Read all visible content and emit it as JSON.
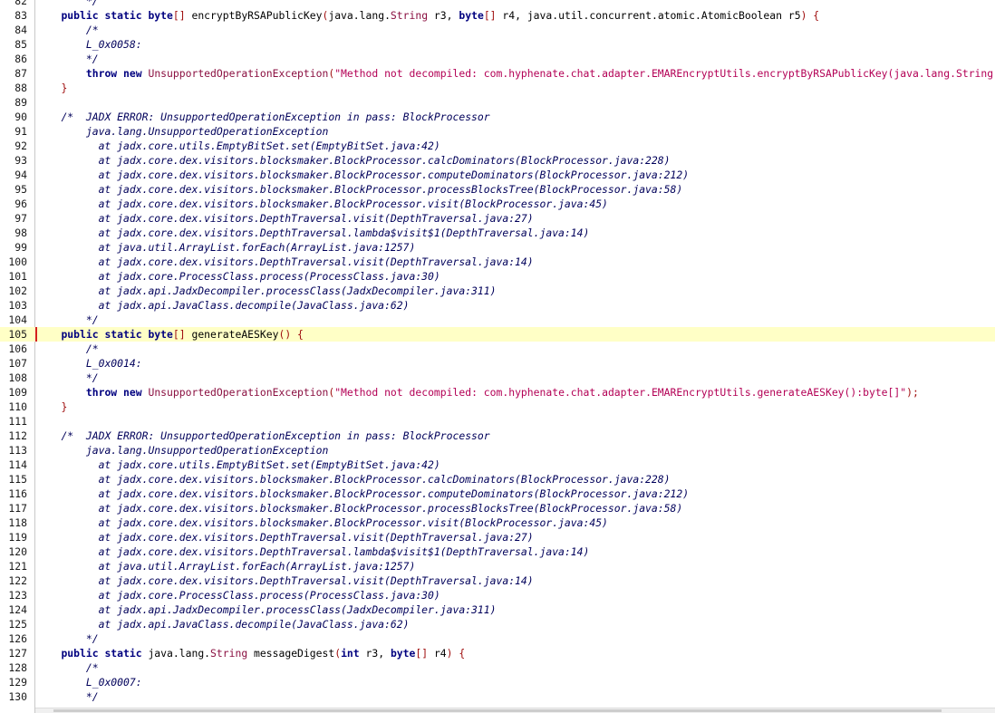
{
  "editor": {
    "current_line": 105,
    "lines": [
      {
        "n": "82",
        "t": [
          {
            "s": "        ",
            "c": "plain"
          },
          {
            "s": "*/",
            "c": "cm"
          }
        ]
      },
      {
        "n": "83",
        "t": [
          {
            "s": "    ",
            "c": "plain"
          },
          {
            "s": "public static byte",
            "c": "kw"
          },
          {
            "s": "[]",
            "c": "pn"
          },
          {
            "s": " encryptByRSAPublicKey",
            "c": "plain"
          },
          {
            "s": "(",
            "c": "pn"
          },
          {
            "s": "java.lang.",
            "c": "plain"
          },
          {
            "s": "String",
            "c": "type"
          },
          {
            "s": " r3, ",
            "c": "plain"
          },
          {
            "s": "byte",
            "c": "kw"
          },
          {
            "s": "[]",
            "c": "pn"
          },
          {
            "s": " r4, java.util.concurrent.atomic.AtomicBoolean r5",
            "c": "plain"
          },
          {
            "s": ") {",
            "c": "pn"
          }
        ]
      },
      {
        "n": "84",
        "t": [
          {
            "s": "        ",
            "c": "plain"
          },
          {
            "s": "/*",
            "c": "cm"
          }
        ]
      },
      {
        "n": "85",
        "t": [
          {
            "s": "        ",
            "c": "plain"
          },
          {
            "s": "L_0x0058:",
            "c": "cm"
          }
        ]
      },
      {
        "n": "86",
        "t": [
          {
            "s": "        ",
            "c": "plain"
          },
          {
            "s": "*/",
            "c": "cm"
          }
        ]
      },
      {
        "n": "87",
        "t": [
          {
            "s": "        ",
            "c": "plain"
          },
          {
            "s": "throw new",
            "c": "kw"
          },
          {
            "s": " UnsupportedOperationException",
            "c": "type"
          },
          {
            "s": "(",
            "c": "pn"
          },
          {
            "s": "\"Method not decompiled: com.hyphenate.chat.adapter.EMAREncryptUtils.encryptByRSAPublicKey(java.lang.String, byte[], java.util.concurrent.atomic.AtomicBoolean):byte[]\"",
            "c": "str"
          },
          {
            "s": ");",
            "c": "pn"
          }
        ]
      },
      {
        "n": "88",
        "t": [
          {
            "s": "    ",
            "c": "plain"
          },
          {
            "s": "}",
            "c": "pn"
          }
        ]
      },
      {
        "n": "89",
        "t": []
      },
      {
        "n": "90",
        "t": [
          {
            "s": "    ",
            "c": "plain"
          },
          {
            "s": "/*  JADX ERROR: UnsupportedOperationException in pass: BlockProcessor",
            "c": "cm"
          }
        ]
      },
      {
        "n": "91",
        "t": [
          {
            "s": "        ",
            "c": "plain"
          },
          {
            "s": "java.lang.UnsupportedOperationException",
            "c": "cm"
          }
        ]
      },
      {
        "n": "92",
        "t": [
          {
            "s": "          ",
            "c": "plain"
          },
          {
            "s": "at jadx.core.utils.EmptyBitSet.set(EmptyBitSet.java:42)",
            "c": "cm"
          }
        ]
      },
      {
        "n": "93",
        "t": [
          {
            "s": "          ",
            "c": "plain"
          },
          {
            "s": "at jadx.core.dex.visitors.blocksmaker.BlockProcessor.calcDominators(BlockProcessor.java:228)",
            "c": "cm"
          }
        ]
      },
      {
        "n": "94",
        "t": [
          {
            "s": "          ",
            "c": "plain"
          },
          {
            "s": "at jadx.core.dex.visitors.blocksmaker.BlockProcessor.computeDominators(BlockProcessor.java:212)",
            "c": "cm"
          }
        ]
      },
      {
        "n": "95",
        "t": [
          {
            "s": "          ",
            "c": "plain"
          },
          {
            "s": "at jadx.core.dex.visitors.blocksmaker.BlockProcessor.processBlocksTree(BlockProcessor.java:58)",
            "c": "cm"
          }
        ]
      },
      {
        "n": "96",
        "t": [
          {
            "s": "          ",
            "c": "plain"
          },
          {
            "s": "at jadx.core.dex.visitors.blocksmaker.BlockProcessor.visit(BlockProcessor.java:45)",
            "c": "cm"
          }
        ]
      },
      {
        "n": "97",
        "t": [
          {
            "s": "          ",
            "c": "plain"
          },
          {
            "s": "at jadx.core.dex.visitors.DepthTraversal.visit(DepthTraversal.java:27)",
            "c": "cm"
          }
        ]
      },
      {
        "n": "98",
        "t": [
          {
            "s": "          ",
            "c": "plain"
          },
          {
            "s": "at jadx.core.dex.visitors.DepthTraversal.lambda$visit$1(DepthTraversal.java:14)",
            "c": "cm"
          }
        ]
      },
      {
        "n": "99",
        "t": [
          {
            "s": "          ",
            "c": "plain"
          },
          {
            "s": "at java.util.ArrayList.forEach(ArrayList.java:1257)",
            "c": "cm"
          }
        ]
      },
      {
        "n": "100",
        "t": [
          {
            "s": "          ",
            "c": "plain"
          },
          {
            "s": "at jadx.core.dex.visitors.DepthTraversal.visit(DepthTraversal.java:14)",
            "c": "cm"
          }
        ]
      },
      {
        "n": "101",
        "t": [
          {
            "s": "          ",
            "c": "plain"
          },
          {
            "s": "at jadx.core.ProcessClass.process(ProcessClass.java:30)",
            "c": "cm"
          }
        ]
      },
      {
        "n": "102",
        "t": [
          {
            "s": "          ",
            "c": "plain"
          },
          {
            "s": "at jadx.api.JadxDecompiler.processClass(JadxDecompiler.java:311)",
            "c": "cm"
          }
        ]
      },
      {
        "n": "103",
        "t": [
          {
            "s": "          ",
            "c": "plain"
          },
          {
            "s": "at jadx.api.JavaClass.decompile(JavaClass.java:62)",
            "c": "cm"
          }
        ]
      },
      {
        "n": "104",
        "t": [
          {
            "s": "        ",
            "c": "plain"
          },
          {
            "s": "*/",
            "c": "cm"
          }
        ]
      },
      {
        "n": "105",
        "t": [
          {
            "s": "    ",
            "c": "plain"
          },
          {
            "s": "public static byte",
            "c": "kw"
          },
          {
            "s": "[]",
            "c": "pn"
          },
          {
            "s": " generateAESKey",
            "c": "plain"
          },
          {
            "s": "() {",
            "c": "pn"
          }
        ]
      },
      {
        "n": "106",
        "t": [
          {
            "s": "        ",
            "c": "plain"
          },
          {
            "s": "/*",
            "c": "cm"
          }
        ]
      },
      {
        "n": "107",
        "t": [
          {
            "s": "        ",
            "c": "plain"
          },
          {
            "s": "L_0x0014:",
            "c": "cm"
          }
        ]
      },
      {
        "n": "108",
        "t": [
          {
            "s": "        ",
            "c": "plain"
          },
          {
            "s": "*/",
            "c": "cm"
          }
        ]
      },
      {
        "n": "109",
        "t": [
          {
            "s": "        ",
            "c": "plain"
          },
          {
            "s": "throw new",
            "c": "kw"
          },
          {
            "s": " UnsupportedOperationException",
            "c": "type"
          },
          {
            "s": "(",
            "c": "pn"
          },
          {
            "s": "\"Method not decompiled: com.hyphenate.chat.adapter.EMAREncryptUtils.generateAESKey():byte[]\"",
            "c": "str"
          },
          {
            "s": ");",
            "c": "pn"
          }
        ]
      },
      {
        "n": "110",
        "t": [
          {
            "s": "    ",
            "c": "plain"
          },
          {
            "s": "}",
            "c": "pn"
          }
        ]
      },
      {
        "n": "111",
        "t": []
      },
      {
        "n": "112",
        "t": [
          {
            "s": "    ",
            "c": "plain"
          },
          {
            "s": "/*  JADX ERROR: UnsupportedOperationException in pass: BlockProcessor",
            "c": "cm"
          }
        ]
      },
      {
        "n": "113",
        "t": [
          {
            "s": "        ",
            "c": "plain"
          },
          {
            "s": "java.lang.UnsupportedOperationException",
            "c": "cm"
          }
        ]
      },
      {
        "n": "114",
        "t": [
          {
            "s": "          ",
            "c": "plain"
          },
          {
            "s": "at jadx.core.utils.EmptyBitSet.set(EmptyBitSet.java:42)",
            "c": "cm"
          }
        ]
      },
      {
        "n": "115",
        "t": [
          {
            "s": "          ",
            "c": "plain"
          },
          {
            "s": "at jadx.core.dex.visitors.blocksmaker.BlockProcessor.calcDominators(BlockProcessor.java:228)",
            "c": "cm"
          }
        ]
      },
      {
        "n": "116",
        "t": [
          {
            "s": "          ",
            "c": "plain"
          },
          {
            "s": "at jadx.core.dex.visitors.blocksmaker.BlockProcessor.computeDominators(BlockProcessor.java:212)",
            "c": "cm"
          }
        ]
      },
      {
        "n": "117",
        "t": [
          {
            "s": "          ",
            "c": "plain"
          },
          {
            "s": "at jadx.core.dex.visitors.blocksmaker.BlockProcessor.processBlocksTree(BlockProcessor.java:58)",
            "c": "cm"
          }
        ]
      },
      {
        "n": "118",
        "t": [
          {
            "s": "          ",
            "c": "plain"
          },
          {
            "s": "at jadx.core.dex.visitors.blocksmaker.BlockProcessor.visit(BlockProcessor.java:45)",
            "c": "cm"
          }
        ]
      },
      {
        "n": "119",
        "t": [
          {
            "s": "          ",
            "c": "plain"
          },
          {
            "s": "at jadx.core.dex.visitors.DepthTraversal.visit(DepthTraversal.java:27)",
            "c": "cm"
          }
        ]
      },
      {
        "n": "120",
        "t": [
          {
            "s": "          ",
            "c": "plain"
          },
          {
            "s": "at jadx.core.dex.visitors.DepthTraversal.lambda$visit$1(DepthTraversal.java:14)",
            "c": "cm"
          }
        ]
      },
      {
        "n": "121",
        "t": [
          {
            "s": "          ",
            "c": "plain"
          },
          {
            "s": "at java.util.ArrayList.forEach(ArrayList.java:1257)",
            "c": "cm"
          }
        ]
      },
      {
        "n": "122",
        "t": [
          {
            "s": "          ",
            "c": "plain"
          },
          {
            "s": "at jadx.core.dex.visitors.DepthTraversal.visit(DepthTraversal.java:14)",
            "c": "cm"
          }
        ]
      },
      {
        "n": "123",
        "t": [
          {
            "s": "          ",
            "c": "plain"
          },
          {
            "s": "at jadx.core.ProcessClass.process(ProcessClass.java:30)",
            "c": "cm"
          }
        ]
      },
      {
        "n": "124",
        "t": [
          {
            "s": "          ",
            "c": "plain"
          },
          {
            "s": "at jadx.api.JadxDecompiler.processClass(JadxDecompiler.java:311)",
            "c": "cm"
          }
        ]
      },
      {
        "n": "125",
        "t": [
          {
            "s": "          ",
            "c": "plain"
          },
          {
            "s": "at jadx.api.JavaClass.decompile(JavaClass.java:62)",
            "c": "cm"
          }
        ]
      },
      {
        "n": "126",
        "t": [
          {
            "s": "        ",
            "c": "plain"
          },
          {
            "s": "*/",
            "c": "cm"
          }
        ]
      },
      {
        "n": "127",
        "t": [
          {
            "s": "    ",
            "c": "plain"
          },
          {
            "s": "public static",
            "c": "kw"
          },
          {
            "s": " java.lang.",
            "c": "plain"
          },
          {
            "s": "String",
            "c": "type"
          },
          {
            "s": " messageDigest",
            "c": "plain"
          },
          {
            "s": "(",
            "c": "pn"
          },
          {
            "s": "int",
            "c": "kw"
          },
          {
            "s": " r3, ",
            "c": "plain"
          },
          {
            "s": "byte",
            "c": "kw"
          },
          {
            "s": "[]",
            "c": "pn"
          },
          {
            "s": " r4",
            "c": "plain"
          },
          {
            "s": ") {",
            "c": "pn"
          }
        ]
      },
      {
        "n": "128",
        "t": [
          {
            "s": "        ",
            "c": "plain"
          },
          {
            "s": "/*",
            "c": "cm"
          }
        ]
      },
      {
        "n": "129",
        "t": [
          {
            "s": "        ",
            "c": "plain"
          },
          {
            "s": "L_0x0007:",
            "c": "cm"
          }
        ]
      },
      {
        "n": "130",
        "t": [
          {
            "s": "        ",
            "c": "plain"
          },
          {
            "s": "*/",
            "c": "cm"
          }
        ]
      }
    ]
  }
}
